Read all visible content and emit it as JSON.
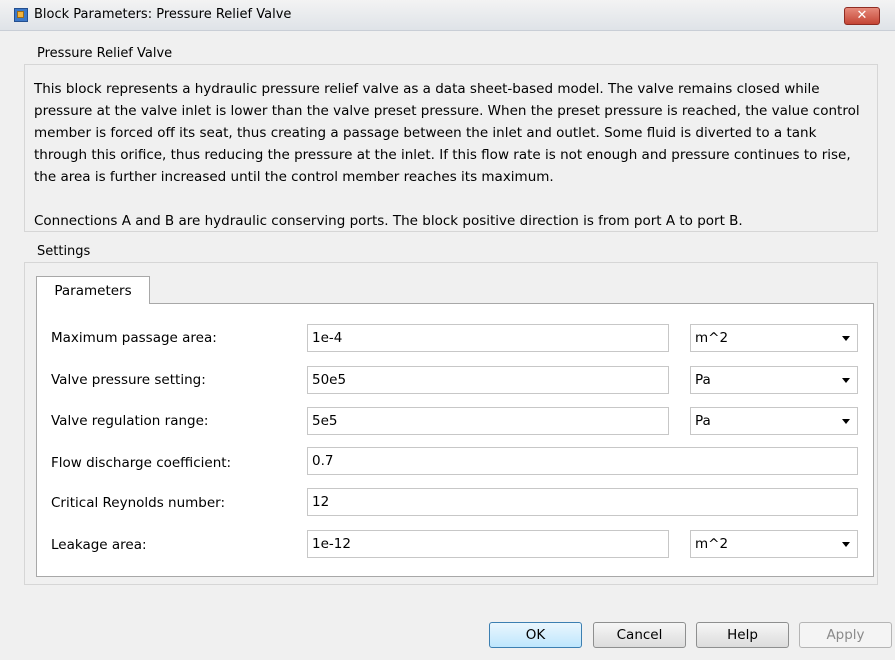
{
  "window": {
    "title": "Block Parameters: Pressure Relief Valve",
    "close_glyph": "✕"
  },
  "description": {
    "group_label": "Pressure Relief Valve",
    "paragraph1": "This block represents a hydraulic pressure relief valve as a  data sheet-based model. The valve remains closed while pressure  at the valve inlet is lower than the valve preset pressure. When the preset pressure is reached, the value control member is forced off its seat, thus creating a passage between the inlet and outlet. Some fluid is diverted to a tank through this orifice, thus reducing the pressure at the inlet. If this flow rate is not enough and pressure continues to rise, the  area is further increased until the control member reaches its maximum.",
    "paragraph2": "Connections A and B are hydraulic conserving ports. The block positive direction is from port A to port B."
  },
  "settings": {
    "group_label": "Settings",
    "tab_label": "Parameters",
    "params": [
      {
        "label": "Maximum passage area:",
        "value": "1e-4",
        "unit": "m^2"
      },
      {
        "label": "Valve pressure setting:",
        "value": "50e5",
        "unit": "Pa"
      },
      {
        "label": "Valve regulation range:",
        "value": "5e5",
        "unit": "Pa"
      },
      {
        "label": "Flow discharge coefficient:",
        "value": "0.7"
      },
      {
        "label": "Critical Reynolds number:",
        "value": "12"
      },
      {
        "label": "Leakage area:",
        "value": "1e-12",
        "unit": "m^2"
      }
    ]
  },
  "buttons": {
    "ok": "OK",
    "cancel": "Cancel",
    "help": "Help",
    "apply": "Apply"
  }
}
